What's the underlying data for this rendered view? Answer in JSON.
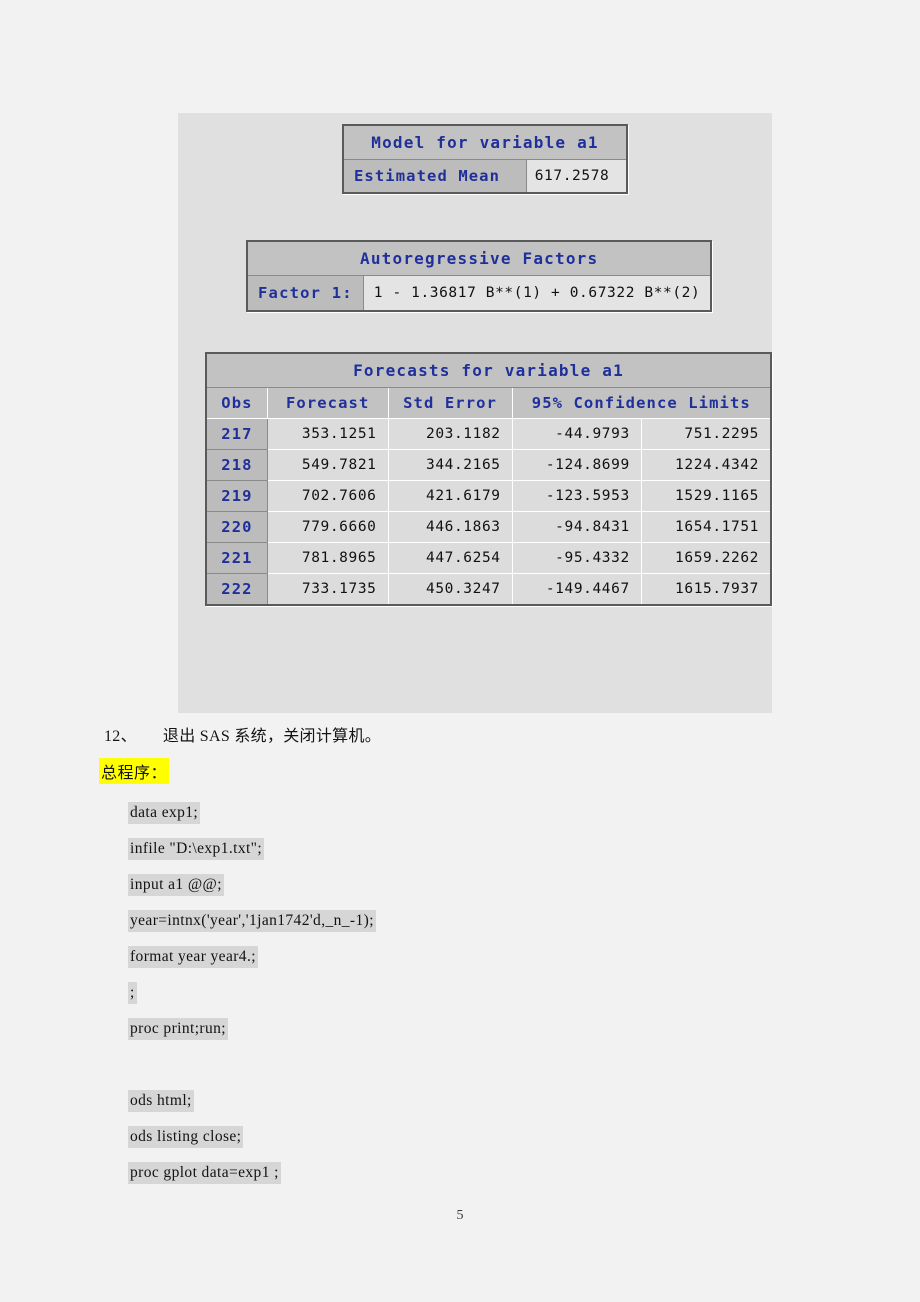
{
  "sas_output": {
    "model_table": {
      "title": "Model for variable a1",
      "mean_label": "Estimated Mean",
      "mean_value": "617.2578"
    },
    "ar_table": {
      "title": "Autoregressive Factors",
      "factor_label": "Factor 1:",
      "factor_value": "1 - 1.36817 B**(1) + 0.67322 B**(2)"
    },
    "forecast_table": {
      "title": "Forecasts for variable a1",
      "headers": [
        "Obs",
        "Forecast",
        "Std Error",
        "95% Confidence Limits"
      ],
      "rows": [
        {
          "obs": "217",
          "forecast": "353.1251",
          "std_error": "203.1182",
          "lower": "-44.9793",
          "upper": "751.2295"
        },
        {
          "obs": "218",
          "forecast": "549.7821",
          "std_error": "344.2165",
          "lower": "-124.8699",
          "upper": "1224.4342"
        },
        {
          "obs": "219",
          "forecast": "702.7606",
          "std_error": "421.6179",
          "lower": "-123.5953",
          "upper": "1529.1165"
        },
        {
          "obs": "220",
          "forecast": "779.6660",
          "std_error": "446.1863",
          "lower": "-94.8431",
          "upper": "1654.1751"
        },
        {
          "obs": "221",
          "forecast": "781.8965",
          "std_error": "447.6254",
          "lower": "-95.4332",
          "upper": "1659.2262"
        },
        {
          "obs": "222",
          "forecast": "733.1735",
          "std_error": "450.3247",
          "lower": "-149.4467",
          "upper": "1615.7937"
        }
      ]
    }
  },
  "document": {
    "step_12_number": "12、",
    "step_12_text": "退出 SAS 系统，关闭计算机。",
    "program_heading": "总程序：",
    "code_lines": [
      "data exp1;",
      "infile \"D:\\exp1.txt\";",
      "input a1 @@;",
      "year=intnx('year','1jan1742'd,_n_-1);",
      "format year year4.;",
      ";",
      "proc print;run;",
      "",
      "ods html;",
      "ods listing close;",
      "proc gplot data=exp1 ;"
    ],
    "page_number": "5"
  },
  "colors": {
    "header_blue": "#20309a",
    "header_gray": "#c2c2c2",
    "cell_gray": "#dcdcdc",
    "image_bg": "#e0e0e0",
    "highlight_yellow": "#ffff00",
    "code_bg": "#d6d6d6",
    "page_bg": "#f2f2f2"
  }
}
